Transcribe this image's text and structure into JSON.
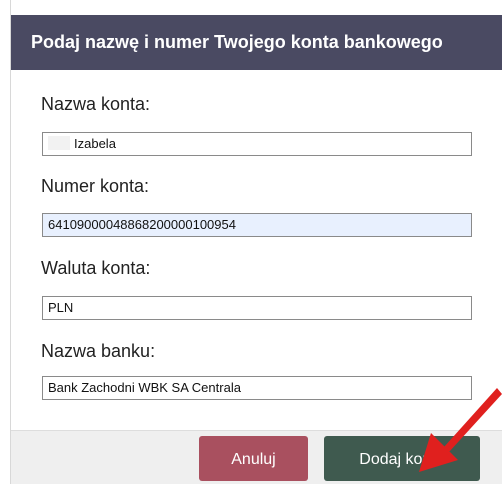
{
  "dialog": {
    "title": "Podaj nazwę i numer Twojego konta bankowego"
  },
  "fields": {
    "account_name": {
      "label": "Nazwa konta:",
      "value": "Izabela"
    },
    "account_number": {
      "label": "Numer konta:",
      "value": "64109000048868200000100954"
    },
    "currency": {
      "label": "Waluta konta:",
      "value": "PLN"
    },
    "bank_name": {
      "label": "Nazwa banku:",
      "value": "Bank Zachodni WBK SA Centrala"
    }
  },
  "buttons": {
    "cancel_label": "Anuluj",
    "add_label": "Dodaj konto"
  },
  "colors": {
    "header_bg": "#4a4a62",
    "cancel_bg": "#a9505f",
    "add_bg": "#3f5a4f",
    "autofill_bg": "#e8f0fe",
    "annotation_arrow": "#e0201e"
  },
  "icons": {
    "annotation": "red-arrow-icon"
  }
}
